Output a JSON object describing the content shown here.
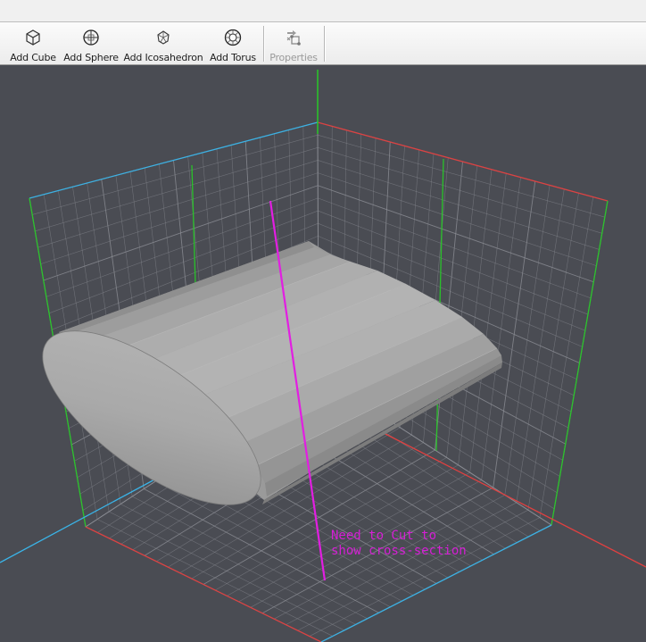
{
  "toolbar": {
    "add_cube": "Add Cube",
    "add_sphere": "Add Sphere",
    "add_icosahedron": "Add Icosahedron",
    "add_torus": "Add Torus",
    "properties": "Properties",
    "icons": [
      "cube-icon",
      "sphere-icon",
      "icosahedron-icon",
      "torus-icon",
      "properties-icon"
    ]
  },
  "viewport": {
    "background": "#4a4c53",
    "axis_colors": {
      "x": "#e04040",
      "y": "#28c828",
      "z": "#3ab4e8"
    },
    "annotation": {
      "line1": "Need to Cut to",
      "line2": "show cross-section",
      "color": "#d61ed6"
    }
  }
}
